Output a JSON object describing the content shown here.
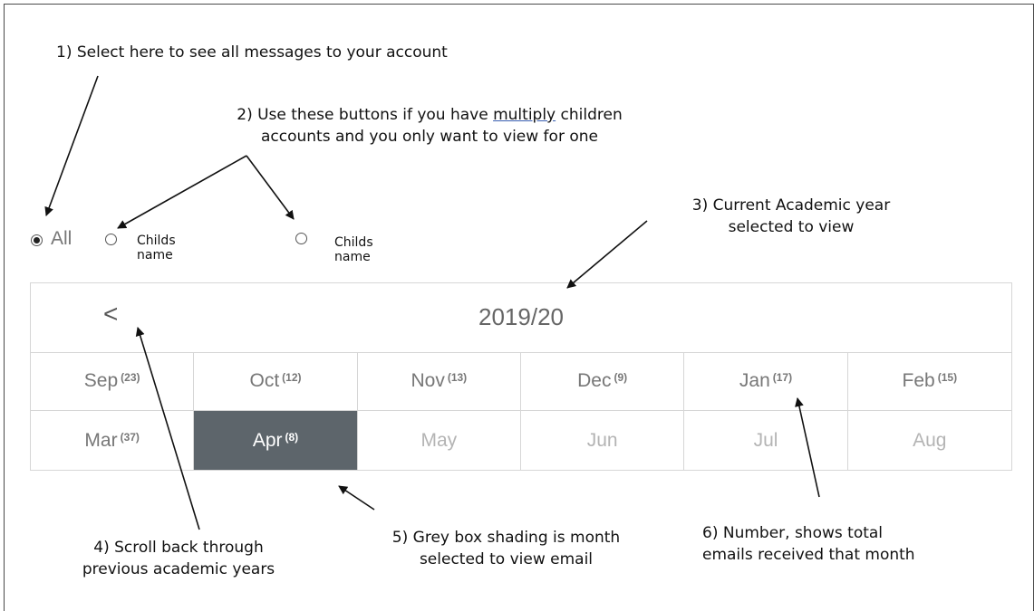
{
  "annotations": {
    "note1": "1)   Select here to see all messages to your account",
    "note2_prefix": "2) Use these buttons if you have ",
    "note2_underlined": "multiply",
    "note2_suffix": " children",
    "note2_line2": "accounts and you only want to view for one",
    "note3_line1": "3) Current Academic year",
    "note3_line2": "selected to view",
    "note4_line1": "4) Scroll back through",
    "note4_line2": "previous academic years",
    "note5_line1": "5) Grey box shading is month",
    "note5_line2": "selected to view email",
    "note6_line1": "6) Number, shows total",
    "note6_line2": "emails received that month"
  },
  "filter": {
    "all_label": "All",
    "child1_label": "Childs name",
    "child2_label": "Childs name",
    "selected": "All"
  },
  "calendar": {
    "prev_label": "<",
    "year": "2019/20",
    "months": [
      {
        "name": "Sep",
        "count": "(23)"
      },
      {
        "name": "Oct",
        "count": "(12)"
      },
      {
        "name": "Nov",
        "count": "(13)"
      },
      {
        "name": "Dec",
        "count": "(9)"
      },
      {
        "name": "Jan",
        "count": "(17)"
      },
      {
        "name": "Feb",
        "count": "(15)"
      },
      {
        "name": "Mar",
        "count": "(37)"
      },
      {
        "name": "Apr",
        "count": "(8)"
      },
      {
        "name": "May",
        "count": ""
      },
      {
        "name": "Jun",
        "count": ""
      },
      {
        "name": "Jul",
        "count": ""
      },
      {
        "name": "Aug",
        "count": ""
      }
    ],
    "selected_month": "Apr",
    "selected_color": "#5d656b"
  }
}
